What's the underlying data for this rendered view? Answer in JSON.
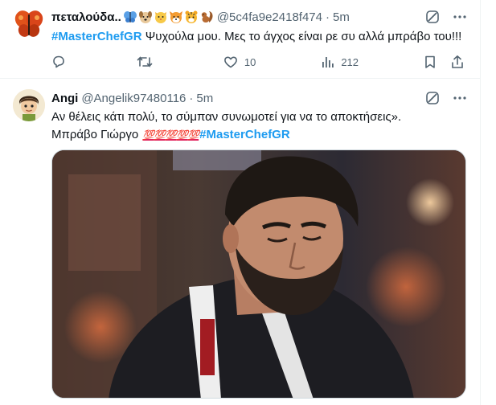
{
  "tweets": [
    {
      "display_name": "πεταλούδα..",
      "emojis": [
        "butterfly-emoji",
        "dog-face-emoji",
        "cat-face-emoji",
        "fox-face-emoji",
        "tiger-face-emoji",
        "squirrel-emoji"
      ],
      "handle": "@5c4fa9e2418f474",
      "separator": "·",
      "time": "5m",
      "hashtag": "#MasterChefGR",
      "text": " Ψυχούλα μου. Μες το άγχος είναι ρε συ αλλά μπράβο του!!!",
      "stats": {
        "reply": "",
        "retweet": "",
        "like": "10",
        "views": "212"
      }
    },
    {
      "display_name": "Angi",
      "handle": "@Angelik97480116",
      "separator": "·",
      "time": "5m",
      "line1": "Αν θέλεις κάτι πολύ, το σύμπαν συνωμοτεί για να το αποκτήσεις».",
      "line2_prefix": "Μπράβο  Γιώργο ",
      "hundreds": [
        "💯",
        "💯",
        "💯",
        "💯",
        "💯"
      ],
      "hashtag": "#MasterChefGR",
      "media_description": "Photo of a bearded man in a black apron in a kitchen studio"
    }
  ],
  "colors": {
    "accent": "#1d9bf0",
    "text": "#0f1419",
    "muted": "#536471",
    "border": "#eff3f4"
  },
  "icons": [
    "grok-icon",
    "more-icon",
    "reply-icon",
    "retweet-icon",
    "like-icon",
    "views-icon",
    "bookmark-icon",
    "share-icon"
  ]
}
